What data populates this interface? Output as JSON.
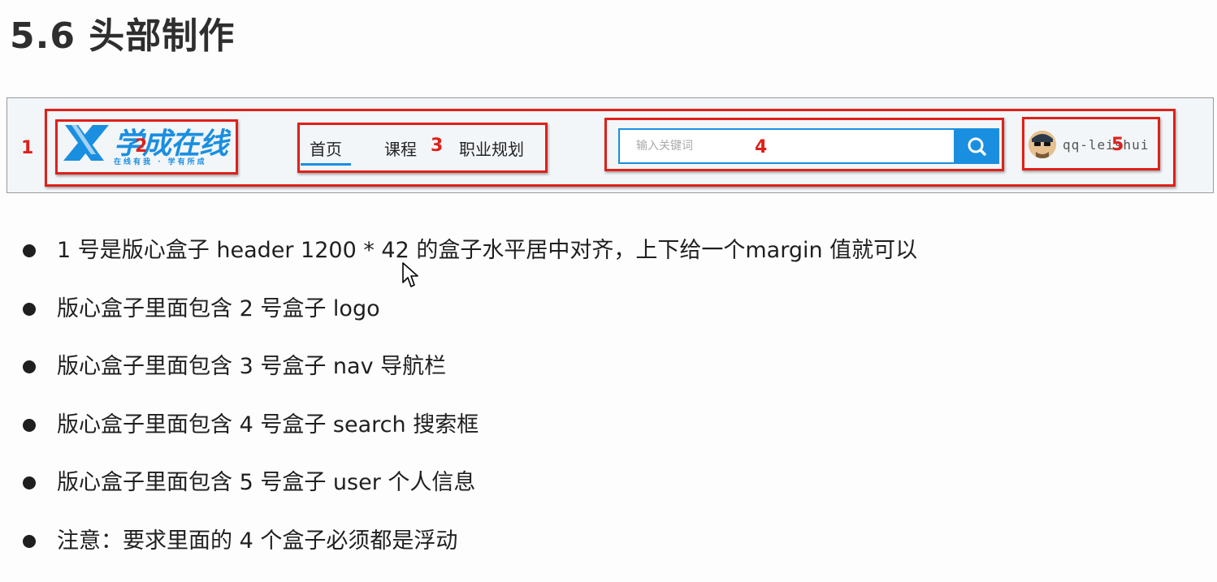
{
  "title": "5.6 头部制作",
  "header_demo": {
    "labels": [
      "1",
      "2",
      "3",
      "4",
      "5"
    ],
    "logo": {
      "text": "学成在线",
      "slogan": "在线有我 · 学有所成"
    },
    "nav": [
      "首页",
      "课程",
      "职业规划"
    ],
    "search": {
      "placeholder": "输入关键词",
      "icon": "search-icon"
    },
    "user": {
      "name": "qq-leishui"
    },
    "colors": {
      "accent": "#1a8fe0",
      "annotation": "#e0201a"
    }
  },
  "bullets": [
    "1 号是版心盒子 header 1200 * 42 的盒子水平居中对齐，上下给一个margin 值就可以",
    "版心盒子里面包含 2 号盒子 logo",
    "版心盒子里面包含 3 号盒子 nav 导航栏",
    "版心盒子里面包含 4 号盒子 search 搜索框",
    "版心盒子里面包含 5 号盒子 user 个人信息",
    "注意：要求里面的 4 个盒子必须都是浮动"
  ]
}
